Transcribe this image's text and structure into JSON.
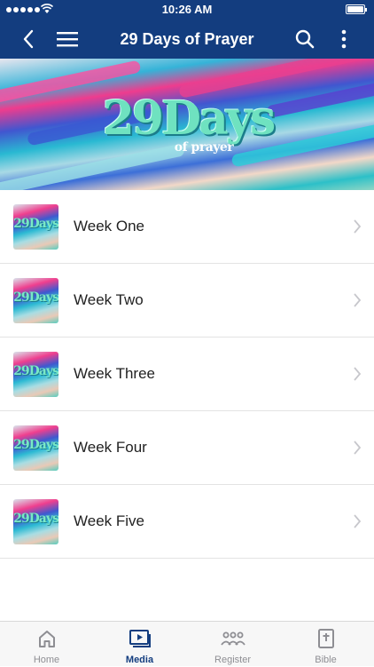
{
  "status_bar": {
    "time": "10:26 AM"
  },
  "nav": {
    "title": "29 Days of Prayer",
    "back_icon": "chevron-left-icon",
    "menu_icon": "hamburger-icon",
    "search_icon": "search-icon",
    "more_icon": "more-vertical-icon"
  },
  "banner": {
    "logo_main": "29Days",
    "logo_sub": "of prayer"
  },
  "thumbnail_text": "29Days",
  "list": {
    "items": [
      {
        "label": "Week One"
      },
      {
        "label": "Week Two"
      },
      {
        "label": "Week Three"
      },
      {
        "label": "Week Four"
      },
      {
        "label": "Week Five"
      }
    ]
  },
  "tabbar": {
    "tabs": [
      {
        "label": "Home",
        "icon": "home-icon"
      },
      {
        "label": "Media",
        "icon": "media-icon",
        "active": true
      },
      {
        "label": "Register",
        "icon": "people-icon"
      },
      {
        "label": "Bible",
        "icon": "bible-icon"
      }
    ]
  },
  "colors": {
    "nav_bg": "#133d7f",
    "active_tab": "#133d7f",
    "inactive_tab": "#8e8e93"
  }
}
